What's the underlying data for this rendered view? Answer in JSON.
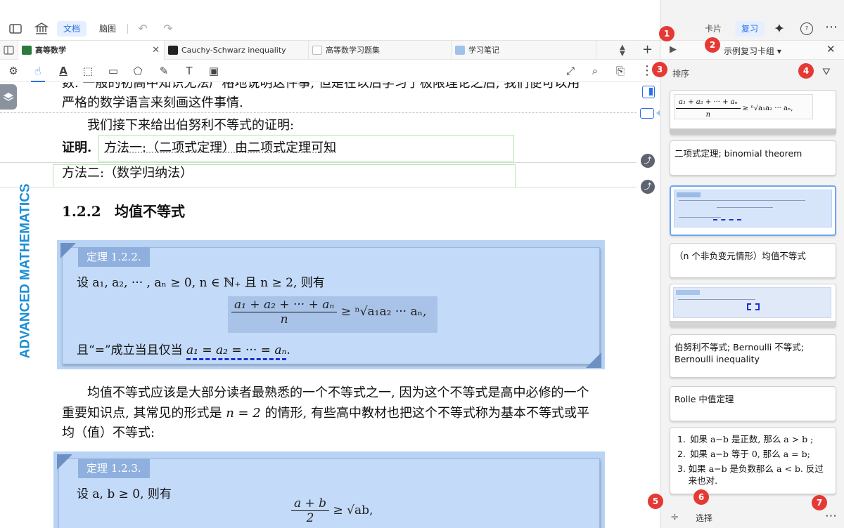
{
  "toolbar": {
    "doc_tab": "文档",
    "mindmap_tab": "脑图"
  },
  "tabs": [
    {
      "label": "高等数学"
    },
    {
      "label": "Cauchy-Schwarz inequality"
    },
    {
      "label": "高等数学习题集"
    },
    {
      "label": "学习笔记"
    }
  ],
  "document": {
    "spine_text": "ADVANCED MATHEMATICS",
    "para_top_1": "数. 一般的初高中知识无法严格地说明这件事, 但是在以后学习了极限理论之后, 我们便可以用",
    "para_top_2": "严格的数学语言来刻画这件事情.",
    "para_proof_intro": "我们接下来给出伯努利不等式的证明:",
    "proof_label": "证明.",
    "method1": "方法一:（二项式定理）由二项式定理可知",
    "method2": "方法二:（数学归纳法）",
    "section_num": "1.2.2",
    "section_title": "均值不等式",
    "thm1_tag": "定理 1.2.2.",
    "thm1_line1": "设 a₁, a₂, ··· , aₙ ≥ 0, n ∈ ℕ₊ 且 n ≥ 2, 则有",
    "thm1_num": "a₁ + a₂ + ··· + aₙ",
    "thm1_den": "n",
    "thm1_rhs": "≥ ⁿ√a₁a₂ ··· aₙ,",
    "thm1_line3_a": "且“=”成立当且仅当",
    "thm1_line3_b": "a₁ = a₂ = ··· = aₙ",
    "thm1_line3_c": ".",
    "para_mid_1": "均值不等式应该是大部分读者最熟悉的一个不等式之一, 因为这个不等式是高中必修的一个",
    "para_mid_2a": "重要知识点, 其常见的形式是",
    "para_mid_2b": "n = 2",
    "para_mid_2c": "的情形, 有些高中教材也把这个不等式称为基本不等式或平",
    "para_mid_3": "均（值）不等式:",
    "thm2_tag": "定理 1.2.3.",
    "thm2_line1": "设 a, b ≥ 0, 则有",
    "thm2_num": "a + b",
    "thm2_den": "2",
    "thm2_rhs": "≥ √ab,"
  },
  "panel": {
    "tab_cards": "卡片",
    "tab_review": "复习",
    "deck_title": "示例复习卡组 ▾",
    "sort_label": "排序",
    "card1_num": "a₁ + a₂ + ··· + aₙ",
    "card1_den": "n",
    "card1_rhs": "≥ ⁿ√a₁a₂ ··· aₙ,",
    "card2": "二项式定理; binomial theorem",
    "card4": "（n 个非负变元情形）均值不等式",
    "card6": "伯努利不等式; Bernoulli 不等式; Bernoulli inequality",
    "card7": "Rolle 中值定理",
    "card8_items": [
      "如果 a−b 是正数, 那么 a > b ;",
      "如果 a−b 等于 0, 那么 a = b;",
      "如果 a−b 是负数那么 a < b. 反过来也对."
    ],
    "select_label": "选择"
  },
  "badges": [
    "1",
    "2",
    "3",
    "4",
    "5",
    "6",
    "7"
  ],
  "colors": {
    "accent": "#2d6fe8",
    "theorem_bg": "#b9d3f5",
    "theorem_tag": "#8fb0de",
    "badge": "#e53935",
    "spine_text": "#1a8fd6"
  }
}
